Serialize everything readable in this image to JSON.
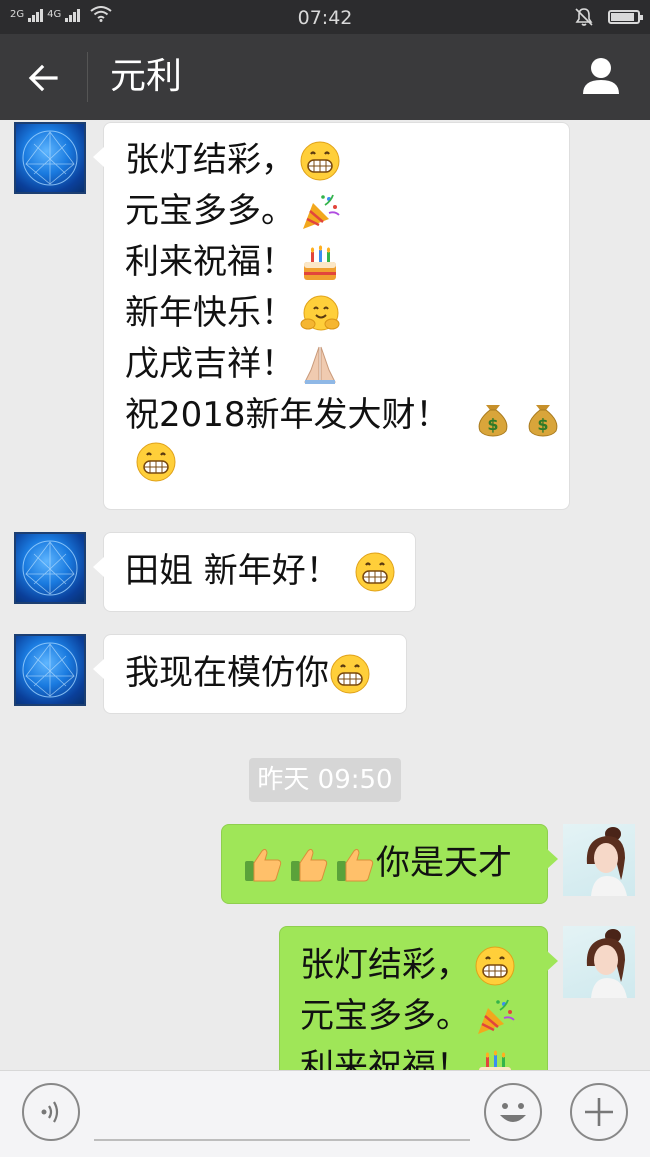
{
  "status_bar": {
    "net1": "2G",
    "net2": "4G",
    "time": "07:42",
    "battery_level": 0.9
  },
  "header": {
    "title": "元利"
  },
  "messages": [
    {
      "side": "left",
      "lines": [
        {
          "text": "张灯结彩，",
          "emoji": [
            "grin"
          ]
        },
        {
          "text": "元宝多多。",
          "emoji": [
            "party-popper"
          ]
        },
        {
          "text": "利来祝福！",
          "emoji": [
            "cake"
          ]
        },
        {
          "text": "新年快乐！",
          "emoji": [
            "hug"
          ]
        },
        {
          "text": "戊戌吉祥！",
          "emoji": [
            "pray"
          ]
        },
        {
          "text": "祝2018新年发大财！",
          "emoji": [
            "money-bag",
            "money-bag"
          ]
        },
        {
          "text": "",
          "emoji": [
            "grin"
          ]
        }
      ]
    },
    {
      "side": "left",
      "lines": [
        {
          "text": "田姐 新年好！",
          "emoji": [
            "grin"
          ]
        }
      ]
    },
    {
      "side": "left",
      "lines": [
        {
          "text": "我现在模仿你",
          "emoji": [
            "grin"
          ]
        }
      ]
    },
    {
      "side": "right",
      "lines": [
        {
          "text": "你是天才",
          "emoji_before": [
            "thumbs-up",
            "thumbs-up",
            "thumbs-up"
          ]
        }
      ]
    },
    {
      "side": "right",
      "lines": [
        {
          "text": "张灯结彩，",
          "emoji": [
            "grin"
          ]
        },
        {
          "text": "元宝多多。",
          "emoji": [
            "party-popper"
          ]
        },
        {
          "text": "利来祝福！",
          "emoji": [
            "cake"
          ]
        }
      ]
    }
  ],
  "timestamp": "昨天 09:50",
  "colors": {
    "accent_green": "#9fe658",
    "header_bg": "#3a3a3c",
    "status_bg": "#2c2c2e"
  },
  "icons": {
    "back": "arrow-left-icon",
    "profile": "person-icon",
    "voice": "voice-icon",
    "emoji": "smiley-icon",
    "add": "plus-icon"
  }
}
